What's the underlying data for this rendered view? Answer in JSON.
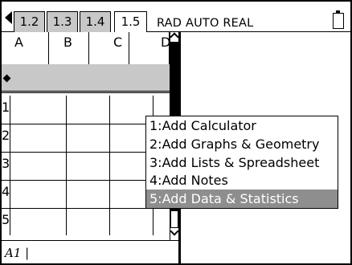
{
  "tabbar": {
    "tabs": [
      {
        "label": "1.2",
        "active": false
      },
      {
        "label": "1.3",
        "active": false
      },
      {
        "label": "1.4",
        "active": false
      },
      {
        "label": "1.5",
        "active": true
      }
    ],
    "settings": "RAD AUTO REAL",
    "battery_icon": "battery-icon"
  },
  "spreadsheet": {
    "columns": [
      "A",
      "B",
      "C",
      "D"
    ],
    "formula_row_icon": "diamond-icon",
    "row_numbers": [
      "1",
      "2",
      "3",
      "4",
      "5"
    ],
    "entry_line": "A1 |"
  },
  "context_menu": {
    "items": [
      {
        "label": "1:Add Calculator",
        "highlighted": false
      },
      {
        "label": "2:Add Graphs & Geometry",
        "highlighted": false
      },
      {
        "label": "3:Add Lists & Spreadsheet",
        "highlighted": false
      },
      {
        "label": "4:Add Notes",
        "highlighted": false
      },
      {
        "label": "5:Add Data & Statistics",
        "highlighted": true
      }
    ]
  },
  "colors": {
    "tab_inactive": "#c8c8c8",
    "formula_row": "#c8c8c8",
    "menu_highlight": "#8e8e8e"
  }
}
